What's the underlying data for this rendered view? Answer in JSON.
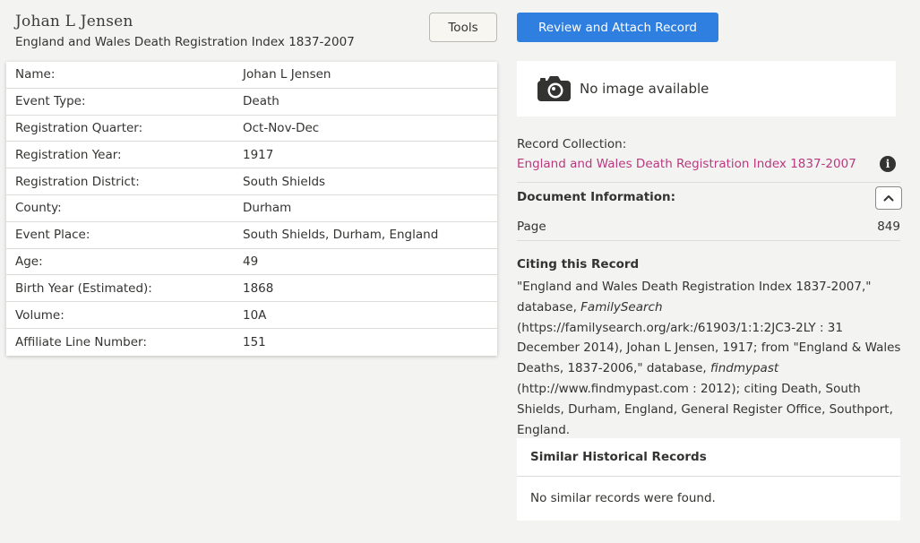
{
  "header": {
    "person_name": "Johan L Jensen",
    "collection_title": "England and Wales Death Registration Index 1837-2007",
    "tools_label": "Tools"
  },
  "record": [
    {
      "label": "Name:",
      "value": "Johan L Jensen"
    },
    {
      "label": "Event Type:",
      "value": "Death"
    },
    {
      "label": "Registration Quarter:",
      "value": "Oct-Nov-Dec"
    },
    {
      "label": "Registration Year:",
      "value": "1917"
    },
    {
      "label": "Registration District:",
      "value": "South Shields"
    },
    {
      "label": "County:",
      "value": "Durham"
    },
    {
      "label": "Event Place:",
      "value": "South Shields, Durham, England"
    },
    {
      "label": "Age:",
      "value": "49"
    },
    {
      "label": "Birth Year (Estimated):",
      "value": "1868"
    },
    {
      "label": "Volume:",
      "value": "10A"
    },
    {
      "label": "Affiliate Line Number:",
      "value": "151"
    }
  ],
  "sidebar": {
    "review_button_label": "Review and Attach Record",
    "no_image_text": "No image available",
    "record_collection_label": "Record Collection:",
    "record_collection_link": "England and Wales Death Registration Index 1837-2007",
    "info_icon": "i",
    "document_info_title": "Document Information:",
    "page_label": "Page",
    "page_value": "849",
    "citing_title": "Citing this Record",
    "citation": {
      "part1": "\"England and Wales Death Registration Index 1837-2007,\" database, ",
      "italic1": "FamilySearch",
      "part2": " (https://familysearch.org/ark:/61903/1:1:2JC3-2LY : 31 December 2014), Johan L Jensen, 1917; from \"England & Wales Deaths, 1837-2006,\" database, ",
      "italic2": "findmypast",
      "part3": " (http://www.findmypast.com : 2012); citing Death, South Shields, Durham, England, General Register Office, Southport, England."
    },
    "similar_title": "Similar Historical Records",
    "similar_empty": "No similar records were found."
  },
  "colors": {
    "background": "#f3f3f2",
    "primary_button": "#2f7fe1",
    "link": "#b8397e"
  },
  "icons": {
    "camera": "camera-icon",
    "info": "info-icon",
    "collapse": "chevron-up-icon"
  }
}
